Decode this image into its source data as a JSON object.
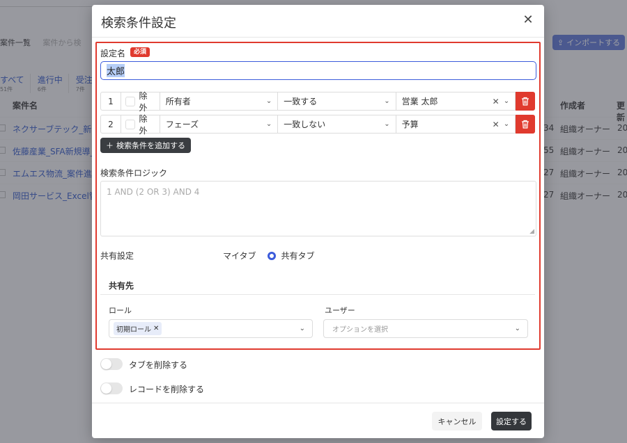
{
  "background": {
    "breadcrumb": "案件一覧",
    "breadcrumb_dim": "案件から検",
    "import_button": "インポートする",
    "tabs": [
      {
        "label": "すべて",
        "count": "51件"
      },
      {
        "label": "進行中",
        "count": "6件"
      },
      {
        "label": "受注",
        "count": "7件"
      }
    ],
    "table": {
      "headers": [
        "案件名",
        "作成者",
        "更新"
      ],
      "rows": [
        {
          "name": "ネクサーブテック_新",
          "num": "34",
          "creator": "組織オーナー",
          "year": "20"
        },
        {
          "name": "佐藤産業_SFA新規導_",
          "num": "55",
          "creator": "組織オーナー",
          "year": "20"
        },
        {
          "name": "エムエス物流_案件進",
          "num": "27",
          "creator": "組織オーナー",
          "year": "20"
        },
        {
          "name": "岡田サービス_Excel管",
          "num": "27",
          "creator": "組織オーナー",
          "year": "20"
        }
      ]
    }
  },
  "modal": {
    "title": "検索条件設定",
    "name_label": "設定名",
    "required_badge": "必須",
    "name_value": "太郎",
    "conditions": [
      {
        "num": "1",
        "exclude_label": "除外",
        "field": "所有者",
        "operator": "一致する",
        "value": "営業 太郎"
      },
      {
        "num": "2",
        "exclude_label": "除外",
        "field": "フェーズ",
        "operator": "一致しない",
        "value": "予算"
      }
    ],
    "add_condition_button": "検索条件を追加する",
    "logic_label": "検索条件ロジック",
    "logic_placeholder": "1 AND (2 OR 3) AND 4",
    "share_label": "共有設定",
    "share_options": {
      "my_tab": "マイタブ",
      "shared_tab": "共有タブ"
    },
    "share_selected": "共有タブ",
    "share_target_title": "共有先",
    "role_label": "ロール",
    "role_tag": "初期ロール",
    "user_label": "ユーザー",
    "user_placeholder": "オプションを選択",
    "delete_tab_toggle": "タブを削除する",
    "delete_record_toggle": "レコードを削除する",
    "cancel_button": "キャンセル",
    "confirm_button": "設定する"
  },
  "colors": {
    "accent": "#3b5bdb",
    "danger": "#e03a2e",
    "dark_button": "#34373b"
  }
}
